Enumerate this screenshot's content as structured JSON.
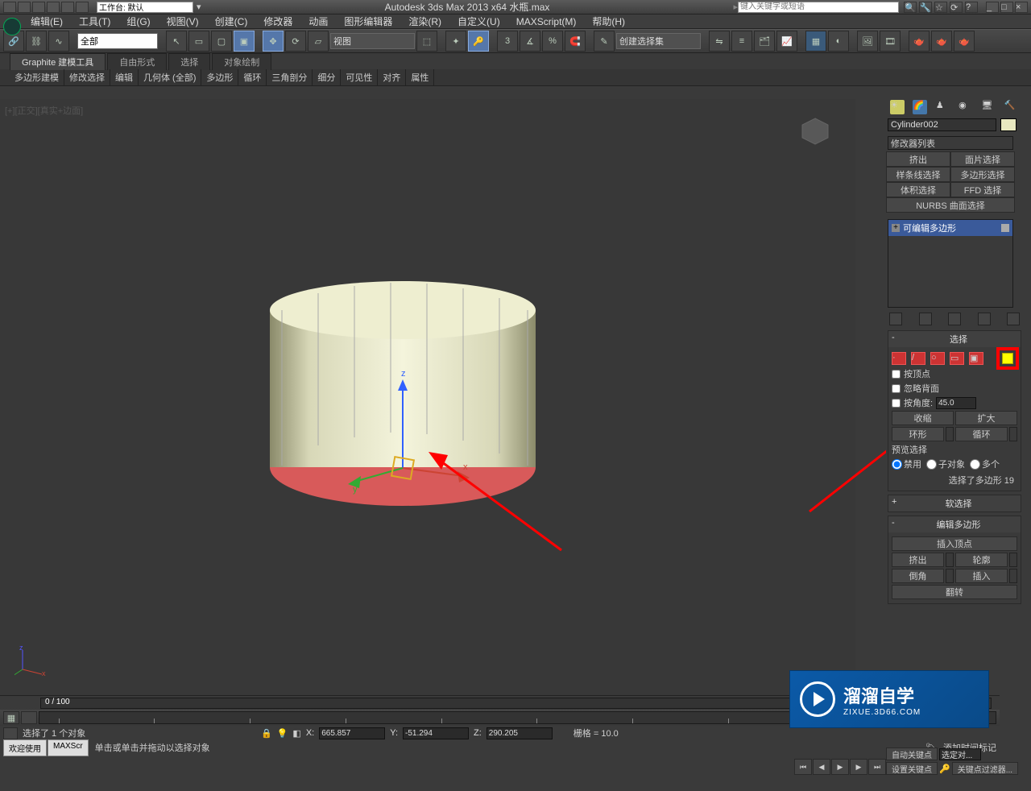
{
  "title": "Autodesk 3ds Max  2013 x64     水瓶.max",
  "workspace_label": "工作台: 默认",
  "search_placeholder": "键入关键字或短语",
  "menus": [
    "编辑(E)",
    "工具(T)",
    "组(G)",
    "视图(V)",
    "创建(C)",
    "修改器",
    "动画",
    "图形编辑器",
    "渲染(R)",
    "自定义(U)",
    "MAXScript(M)",
    "帮助(H)"
  ],
  "toolbar_filter": "全部",
  "toolbar_viewmode": "视图",
  "create_set": "创建选择集",
  "ribbon_tabs": [
    "Graphite 建模工具",
    "自由形式",
    "选择",
    "对象绘制"
  ],
  "ribbon_sections": [
    "多边形建模",
    "修改选择",
    "编辑",
    "几何体 (全部)",
    "多边形",
    "循环",
    "三角剖分",
    "细分",
    "可见性",
    "对齐",
    "属性"
  ],
  "viewport_label": "[+][正交][真实+边面]",
  "object_name": "Cylinder002",
  "modifier_list_label": "修改器列表",
  "modifier_btns": [
    "挤出",
    "面片选择",
    "样条线选择",
    "多边形选择",
    "体积选择",
    "FFD 选择"
  ],
  "modifier_wide": "NURBS 曲面选择",
  "stack_item": "可编辑多边形",
  "rollout_select": "选择",
  "chk_byvertex": "按顶点",
  "chk_ignoreback": "忽略背面",
  "chk_byangle": "按角度:",
  "angle_value": "45.0",
  "btn_shrink": "收缩",
  "btn_grow": "扩大",
  "btn_ring": "环形",
  "btn_loop": "循环",
  "preview_label": "预览选择",
  "radio_disable": "禁用",
  "radio_subobj": "子对象",
  "radio_multiple": "多个",
  "selection_status": "选择了多边形 19",
  "rollout_soft": "软选择",
  "rollout_editpoly": "编辑多边形",
  "btn_insertvert": "插入顶点",
  "btn_extrude": "挤出",
  "btn_outline": "轮廓",
  "btn_bevel": "倒角",
  "btn_inset": "插入",
  "btn_flip": "翻转",
  "timeline": "0 / 100",
  "status_selected": "选择了 1 个对象",
  "status_hint": "单击或单击并拖动以选择对象",
  "coord_x": "665.857",
  "coord_y": "-51.294",
  "coord_z": "290.205",
  "grid_label": "栅格 = 10.0",
  "addtime_label": "添加时间标记",
  "auto_key": "自动关键点",
  "set_key": "设置关键点",
  "key_filter": "关键点过滤器...",
  "sel_lock": "选定对...",
  "welcome_tabs": [
    "欢迎使用",
    "MAXScr"
  ],
  "watermark_main": "溜溜自学",
  "watermark_sub": "ZIXUE.3D66.COM"
}
